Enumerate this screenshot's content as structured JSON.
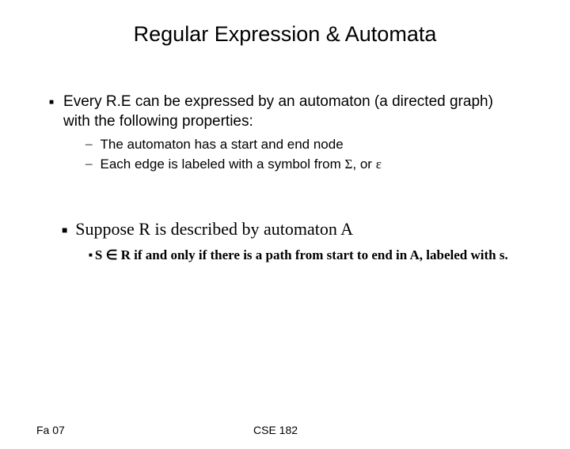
{
  "title": "Regular Expression & Automata",
  "bullet1": "Every R.E can be expressed by an automaton (a directed graph) with the following properties:",
  "sub1": "The automaton has a start and end node",
  "sub2_a": "Each edge is labeled with a symbol from ",
  "sub2_sigma": "Σ",
  "sub2_b": ", or ",
  "sub2_eps": "ε",
  "bullet2": "Suppose R is described by automaton A",
  "bullet3_a": "S ",
  "bullet3_in": "∈",
  "bullet3_b": " R if and only if there is a path from start to end in A, labeled with s.",
  "footer_left": "Fa 07",
  "footer_center": "CSE 182"
}
